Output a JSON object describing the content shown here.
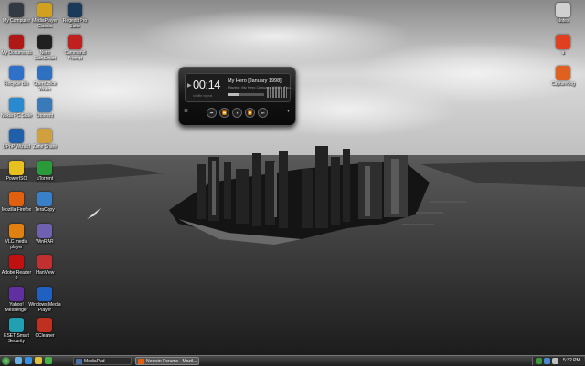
{
  "desktop": {
    "icons_left": [
      {
        "label": "My Computer",
        "icon": "computer-icon",
        "color": "#333a44"
      },
      {
        "label": "My Documents",
        "icon": "documents-icon",
        "color": "#b01818"
      },
      {
        "label": "Recycle Bin",
        "icon": "recycle-bin-icon",
        "color": "#2f70c8"
      },
      {
        "label": "Nokia PC Suite",
        "icon": "nokia-icon",
        "color": "#2a8ad0"
      },
      {
        "label": "UPnP Wizard",
        "icon": "upnp-icon",
        "color": "#2060a8"
      },
      {
        "label": "PowerISO",
        "icon": "poweriso-icon",
        "color": "#e8c020"
      },
      {
        "label": "Mozilla Firefox",
        "icon": "firefox-icon",
        "color": "#e06010"
      },
      {
        "label": "VLC media player",
        "icon": "vlc-icon",
        "color": "#e08010"
      },
      {
        "label": "Adobe Reader 8",
        "icon": "adobe-reader-icon",
        "color": "#c01010"
      },
      {
        "label": "Yahoo! Messenger",
        "icon": "yahoo-messenger-icon",
        "color": "#6030a0"
      },
      {
        "label": "ESET Smart Security",
        "icon": "eset-icon",
        "color": "#20a0b0"
      }
    ],
    "icons_col2": [
      {
        "label": "MediaPlayer Classic",
        "icon": "mpc-icon",
        "color": "#d0a020"
      },
      {
        "label": "Nero StartSmart",
        "icon": "nero-icon",
        "color": "#202020"
      },
      {
        "label": "OpenOffice Writer",
        "icon": "openoffice-icon",
        "color": "#3070c0"
      },
      {
        "label": "Utorrent",
        "icon": "utorrent-icon",
        "color": "#3a7ab8"
      },
      {
        "label": "Zune Share",
        "icon": "zune-icon",
        "color": "#d0a040"
      },
      {
        "label": "µTorrent",
        "icon": "utorrent-green-icon",
        "color": "#2a9a3a"
      },
      {
        "label": "TeraCopy",
        "icon": "teracopy-icon",
        "color": "#3a80c8"
      },
      {
        "label": "WinRAR",
        "icon": "winrar-icon",
        "color": "#7060b0"
      },
      {
        "label": "IrfanView",
        "icon": "irfanview-icon",
        "color": "#c03030"
      },
      {
        "label": "Windows Media Player",
        "icon": "wmp-icon",
        "color": "#2060c0"
      },
      {
        "label": "CCleaner",
        "icon": "ccleaner-icon",
        "color": "#c03020"
      }
    ],
    "icons_col3": [
      {
        "label": "Regedit Pro Suite",
        "icon": "steam-icon",
        "color": "#1a3a5a"
      },
      {
        "label": "Command Prompt",
        "icon": "cmd-icon",
        "color": "#c02020"
      }
    ],
    "icons_right": [
      {
        "label": "Notes",
        "icon": "notes-icon",
        "color": "#d0d0d0"
      },
      {
        "label": "a",
        "icon": "document-icon",
        "color": "#e04020"
      },
      {
        "label": "Capture.log",
        "icon": "log-icon",
        "color": "#e06020"
      }
    ]
  },
  "player": {
    "time": "00:14",
    "song_title": "My Hero [January 1998]",
    "song_subtitle": "Playing: My Hero [January 1998] - Foo...",
    "status_left": "shuffle  repeat",
    "progress": 0.3,
    "controls": [
      "⏮",
      "⏪",
      "⏸",
      "⏩",
      "⏭"
    ]
  },
  "taskbar": {
    "tasks": [
      {
        "label": "MediaPad",
        "icon_color": "#4a70a8"
      },
      {
        "label": "Neowin Forums - Mozil...",
        "icon_color": "#e06010"
      }
    ],
    "clock": "5:32 PM",
    "quick_launch_colors": [
      "#6ab0e0",
      "#3a90e0",
      "#e0c040",
      "#4ab04a"
    ],
    "tray_colors": [
      "#3a9a3a",
      "#4a8ad0",
      "#c0c0c0"
    ]
  }
}
